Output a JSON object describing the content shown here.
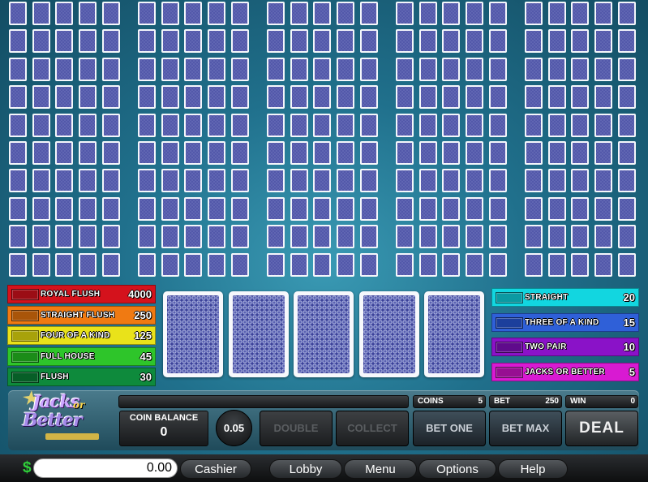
{
  "paytable_left": [
    {
      "name": "ROYAL FLUSH",
      "value": "4000",
      "color": "#d4121c",
      "swatch": "#9b0d15"
    },
    {
      "name": "STRAIGHT FLUSH",
      "value": "250",
      "color": "#f07a12",
      "swatch": "#a95509"
    },
    {
      "name": "FOUR OF A KIND",
      "value": "125",
      "color": "#e9e21a",
      "swatch": "#a8a20a"
    },
    {
      "name": "FULL HOUSE",
      "value": "45",
      "color": "#2ec52a",
      "swatch": "#1b8c18"
    },
    {
      "name": "FLUSH",
      "value": "30",
      "color": "#0e8a3c",
      "swatch": "#075e27"
    }
  ],
  "paytable_right": [
    {
      "name": "STRAIGHT",
      "value": "20",
      "color": "#12d6e0",
      "swatch": "#0b9aa2"
    },
    {
      "name": "THREE OF A KIND",
      "value": "15",
      "color": "#2f60d8",
      "swatch": "#1c3f9c"
    },
    {
      "name": "TWO PAIR",
      "value": "10",
      "color": "#8a12c8",
      "swatch": "#5f0b8c"
    },
    {
      "name": "JACKS OR BETTER",
      "value": "5",
      "color": "#d81ad2",
      "swatch": "#970f92"
    }
  ],
  "logo": {
    "line1": "Jacks",
    "line2": "or",
    "line3": "Better"
  },
  "coin_balance": {
    "label": "COIN BALANCE",
    "value": "0"
  },
  "coin_value": "0.05",
  "buttons": {
    "double": "DOUBLE",
    "collect": "COLLECT",
    "bet_one": "BET ONE",
    "bet_max": "BET MAX",
    "deal": "DEAL"
  },
  "coins": {
    "label": "COINS",
    "value": "5"
  },
  "bet": {
    "label": "BET",
    "value": "250"
  },
  "win": {
    "label": "WIN",
    "value": "0"
  },
  "bottom": {
    "currency": "$",
    "balance": "0.00",
    "cashier": "Cashier",
    "lobby": "Lobby",
    "menu": "Menu",
    "options": "Options",
    "help": "Help"
  }
}
